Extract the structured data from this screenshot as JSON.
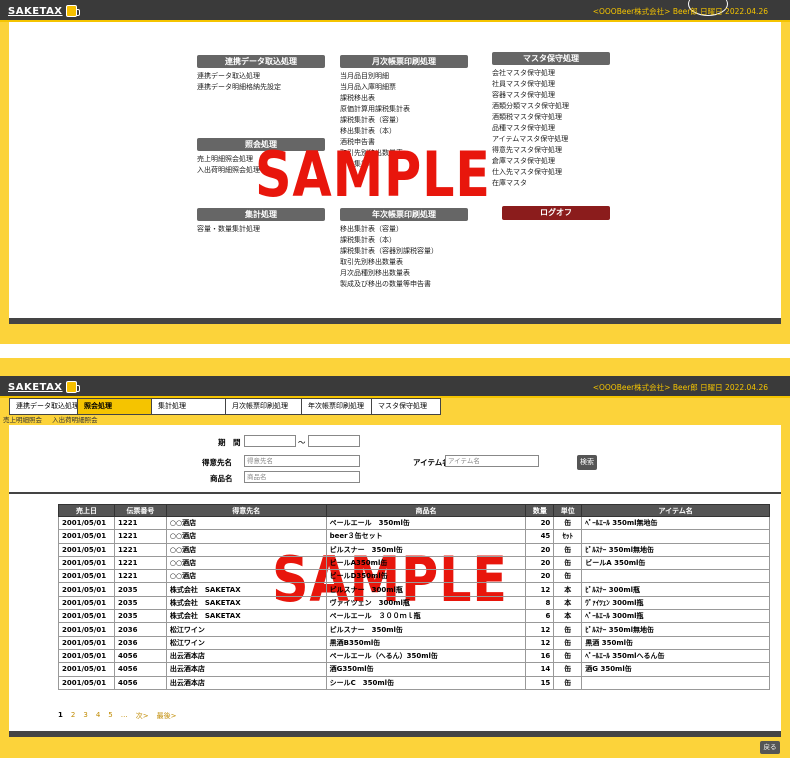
{
  "app": {
    "logo": "SAKETAX",
    "company_date": "<OOOBeer株式会社> Beer郎 日曜日 2022.04.26"
  },
  "watermark": "SAMPLE",
  "menu": {
    "renkei": {
      "title": "連携データ取込処理",
      "items": [
        "連携データ取込処理",
        "連携データ明細格納先設定"
      ]
    },
    "shokai": {
      "title": "照会処理",
      "items": [
        "売上明細照会処理",
        "入出荷明細照会処理"
      ]
    },
    "shukei": {
      "title": "集計処理",
      "items": [
        "容量・数量集計処理"
      ]
    },
    "geppyo": {
      "title": "月次帳票印刷処理",
      "items": [
        "当月品目別明細",
        "当月品入庫明細票",
        "課税移出表",
        "原価計算用課税集計表",
        "課税集計表（容量）",
        "移出集計表（本）",
        "酒税申告書",
        "取引先別移出数量表",
        "月次集計表"
      ]
    },
    "nenji": {
      "title": "年次帳票印刷処理",
      "items": [
        "移出集計表（容量）",
        "課税集計表（本）",
        "課税集計表（容器別課税容量）",
        "取引先別移出数量表",
        "月次品種別移出数量表",
        "製成及び移出の数量等申告書"
      ]
    },
    "master": {
      "title": "マスタ保守処理",
      "items": [
        "会社マスタ保守処理",
        "社員マスタ保守処理",
        "容器マスタ保守処理",
        "酒類分類マスタ保守処理",
        "酒類税マスタ保守処理",
        "品種マスタ保守処理",
        "アイテムマスタ保守処理",
        "得意先マスタ保守処理",
        "倉庫マスタ保守処理",
        "仕入先マスタ保守処理",
        "在庫マスタ"
      ]
    },
    "logout": "ログオフ"
  },
  "tabs": [
    "連携データ取込処理",
    "照会処理",
    "集計処理",
    "月次帳票印刷処理",
    "年次帳票印刷処理",
    "マスタ保守処理"
  ],
  "breadcrumb": [
    "売上明細照会",
    "入出荷明細照会"
  ],
  "form": {
    "date_label": "期　間",
    "date_sep": "～",
    "customer_label": "得意先名",
    "customer_placeholder": "得意先名",
    "product_label": "商品名",
    "product_placeholder": "商品名",
    "item_label": "アイテム名",
    "item_placeholder": "アイテム名",
    "search": "検索"
  },
  "table": {
    "headers": [
      "売上日",
      "伝票番号",
      "得意先名",
      "商品名",
      "数量",
      "単位",
      "アイテム名"
    ],
    "rows": [
      [
        "2001/05/01",
        "1221",
        "○○酒店",
        "ペールエール　350ml缶",
        "20",
        "缶",
        "ﾍﾟｰﾙｴｰﾙ 350ml無地缶"
      ],
      [
        "2001/05/01",
        "1221",
        "○○酒店",
        "beer３缶セット",
        "45",
        "ｾｯﾄ",
        ""
      ],
      [
        "2001/05/01",
        "1221",
        "○○酒店",
        "ピルスナー　350ml缶",
        "20",
        "缶",
        "ﾋﾟﾙｽﾅｰ 350ml無地缶"
      ],
      [
        "2001/05/01",
        "1221",
        "○○酒店",
        "ビールA350ml缶",
        "20",
        "缶",
        "ビールA 350ml缶"
      ],
      [
        "2001/05/01",
        "1221",
        "○○酒店",
        "ビールD350ml缶",
        "20",
        "缶",
        ""
      ],
      [
        "2001/05/01",
        "2035",
        "株式会社　SAKETAX",
        "ピルスナー　300ml瓶",
        "12",
        "本",
        "ﾋﾟﾙｽﾅｰ 300ml瓶"
      ],
      [
        "2001/05/01",
        "2035",
        "株式会社　SAKETAX",
        "ヴァイツェン　300ml瓶",
        "8",
        "本",
        "ｳﾞｧｲﾂｪﾝ 300ml瓶"
      ],
      [
        "2001/05/01",
        "2035",
        "株式会社　SAKETAX",
        "ペールエール　３００ｍｌ瓶",
        "6",
        "本",
        "ﾍﾟｰﾙｴｰﾙ 300ml瓶"
      ],
      [
        "2001/05/01",
        "2036",
        "松江ワイン",
        "ピルスナー　350ml缶",
        "12",
        "缶",
        "ﾋﾟﾙｽﾅｰ 350ml無地缶"
      ],
      [
        "2001/05/01",
        "2036",
        "松江ワイン",
        "黒酒B350ml缶",
        "12",
        "缶",
        "黒酒 350ml缶"
      ],
      [
        "2001/05/01",
        "4056",
        "出云酒本店",
        "ペールエール（へるん）350ml缶",
        "16",
        "缶",
        "ﾍﾟｰﾙｴｰﾙ 350mlへるん缶"
      ],
      [
        "2001/05/01",
        "4056",
        "出云酒本店",
        "酒G350ml缶",
        "14",
        "缶",
        "酒G 350ml缶"
      ],
      [
        "2001/05/01",
        "4056",
        "出云酒本店",
        "シールC　350ml缶",
        "15",
        "缶",
        ""
      ]
    ]
  },
  "pager": {
    "pages": [
      "1",
      "2",
      "3",
      "4",
      "5"
    ],
    "ellipsis": "…",
    "next": "次>",
    "last": "最後>"
  },
  "back": "戻る"
}
